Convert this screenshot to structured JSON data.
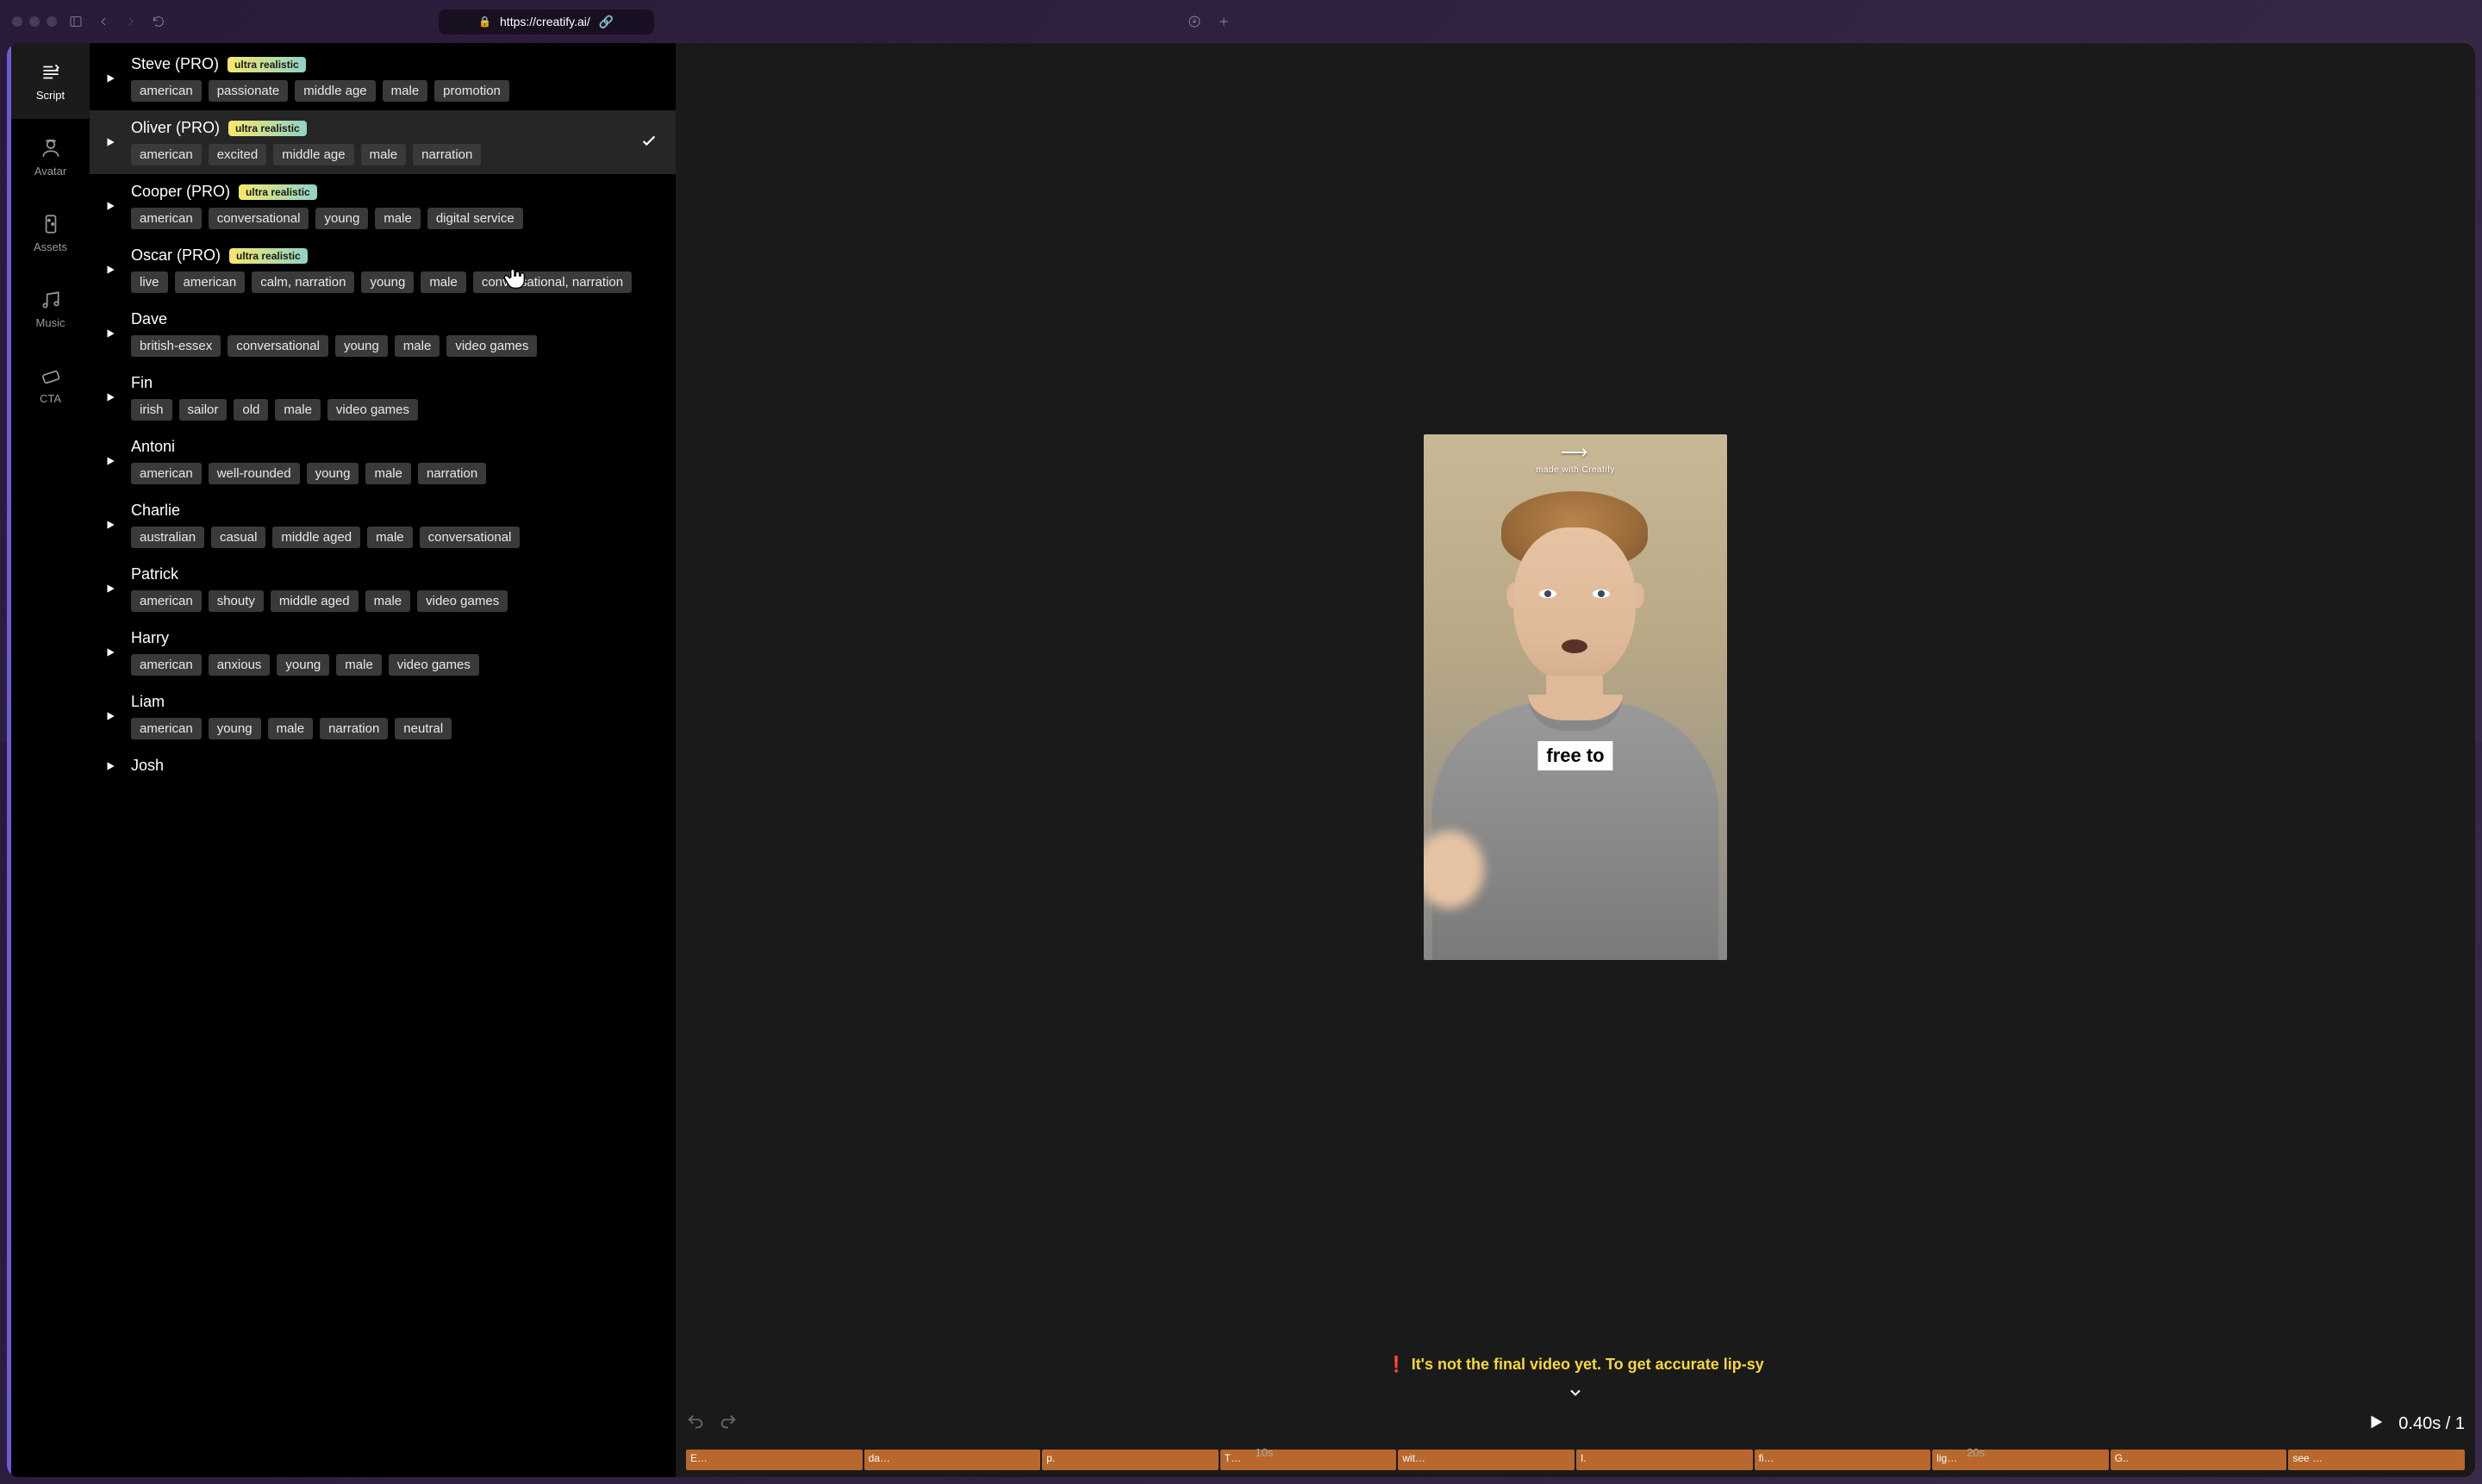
{
  "browser": {
    "url": "https://creatify.ai/",
    "buttons": {
      "back": "←",
      "forward": "→",
      "reload": "↻",
      "share": "⤴",
      "download": "↓",
      "new_tab": "+"
    }
  },
  "nav": {
    "items": [
      {
        "id": "script",
        "label": "Script",
        "active": true
      },
      {
        "id": "avatar",
        "label": "Avatar",
        "active": false
      },
      {
        "id": "assets",
        "label": "Assets",
        "active": false
      },
      {
        "id": "music",
        "label": "Music",
        "active": false
      },
      {
        "id": "cta",
        "label": "CTA",
        "active": false
      }
    ]
  },
  "voices": [
    {
      "name": "Steve (PRO)",
      "badge": "ultra realistic",
      "selected": false,
      "tags": [
        "american",
        "passionate",
        "middle age",
        "male",
        "promotion"
      ]
    },
    {
      "name": "Oliver (PRO)",
      "badge": "ultra realistic",
      "selected": true,
      "tags": [
        "american",
        "excited",
        "middle age",
        "male",
        "narration"
      ]
    },
    {
      "name": "Cooper (PRO)",
      "badge": "ultra realistic",
      "selected": false,
      "tags": [
        "american",
        "conversational",
        "young",
        "male",
        "digital service"
      ]
    },
    {
      "name": "Oscar (PRO)",
      "badge": "ultra realistic",
      "selected": false,
      "tags": [
        "live",
        "american",
        "calm, narration",
        "young",
        "male",
        "conversational, narration"
      ]
    },
    {
      "name": "Dave",
      "badge": null,
      "selected": false,
      "tags": [
        "british-essex",
        "conversational",
        "young",
        "male",
        "video games"
      ]
    },
    {
      "name": "Fin",
      "badge": null,
      "selected": false,
      "tags": [
        "irish",
        "sailor",
        "old",
        "male",
        "video games"
      ]
    },
    {
      "name": "Antoni",
      "badge": null,
      "selected": false,
      "tags": [
        "american",
        "well-rounded",
        "young",
        "male",
        "narration"
      ]
    },
    {
      "name": "Charlie",
      "badge": null,
      "selected": false,
      "tags": [
        "australian",
        "casual",
        "middle aged",
        "male",
        "conversational"
      ]
    },
    {
      "name": "Patrick",
      "badge": null,
      "selected": false,
      "tags": [
        "american",
        "shouty",
        "middle aged",
        "male",
        "video games"
      ]
    },
    {
      "name": "Harry",
      "badge": null,
      "selected": false,
      "tags": [
        "american",
        "anxious",
        "young",
        "male",
        "video games"
      ]
    },
    {
      "name": "Liam",
      "badge": null,
      "selected": false,
      "tags": [
        "american",
        "young",
        "male",
        "narration",
        "neutral"
      ]
    },
    {
      "name": "Josh",
      "badge": null,
      "selected": false,
      "tags": []
    }
  ],
  "preview": {
    "watermark_label": "made with Creatify",
    "caption": "free to",
    "warning": "It's not the final video yet. To get accurate lip-sy"
  },
  "timeline": {
    "time": "0.40s / 1",
    "marks": [
      "10s",
      "20s"
    ],
    "clips": [
      "E…",
      "da…",
      "p.",
      "T…",
      "wit…",
      "I.",
      "fi…",
      "lig…",
      "G..",
      "see …"
    ]
  }
}
